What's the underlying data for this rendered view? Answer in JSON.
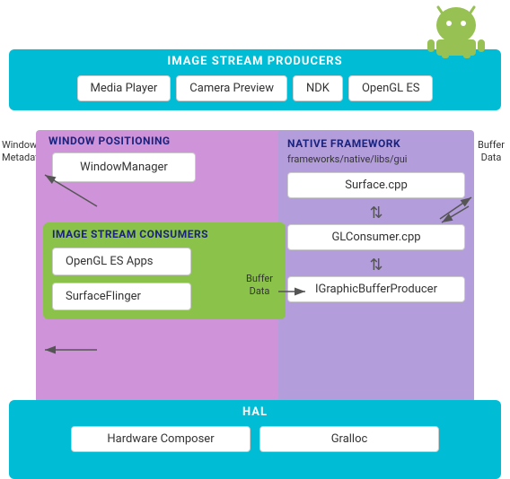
{
  "android_robot": {
    "alt": "Android Robot"
  },
  "image_stream_producers": {
    "title": "IMAGE STREAM PRODUCERS",
    "items": [
      {
        "label": "Media Player"
      },
      {
        "label": "Camera Preview"
      },
      {
        "label": "NDK"
      },
      {
        "label": "OpenGL ES"
      }
    ]
  },
  "left_label": {
    "text": "Window\nMetadata"
  },
  "right_label": {
    "text": "Buffer\nData"
  },
  "window_positioning": {
    "title": "WINDOW POSITIONING",
    "window_manager": "WindowManager"
  },
  "image_stream_consumers": {
    "title": "IMAGE STREAM CONSUMERS",
    "items": [
      {
        "label": "OpenGL ES Apps"
      },
      {
        "label": "SurfaceFlinger"
      }
    ]
  },
  "buffer_data_small": {
    "line1": "Buffer",
    "line2": "Data"
  },
  "native_framework": {
    "title": "NATIVE FRAMEWORK",
    "path": "frameworks/native/libs/gui",
    "items": [
      {
        "label": "Surface.cpp"
      },
      {
        "label": "GLConsumer.cpp"
      },
      {
        "label": "IGraphicBufferProducer"
      }
    ]
  },
  "hal": {
    "title": "HAL",
    "items": [
      {
        "label": "Hardware Composer"
      },
      {
        "label": "Gralloc"
      }
    ]
  }
}
